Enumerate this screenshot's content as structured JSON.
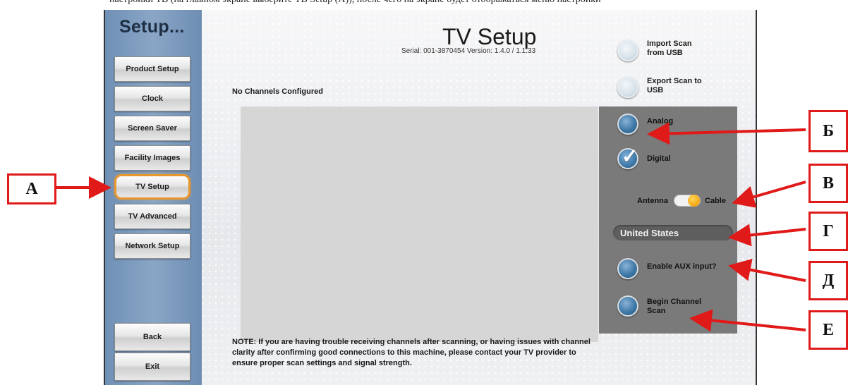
{
  "top_strip_text": "настройки ТВ (на главном экране выберите ТВ Setup (А)), после чего на экране будет отображаться меню настройки",
  "sidebar": {
    "title": "Setup...",
    "items": [
      {
        "label": "Product Setup"
      },
      {
        "label": "Clock"
      },
      {
        "label": "Screen Saver"
      },
      {
        "label": "Facility Images"
      },
      {
        "label": "TV Setup",
        "active": true
      },
      {
        "label": "TV Advanced"
      },
      {
        "label": "Network Setup"
      }
    ],
    "back_label": "Back",
    "exit_label": "Exit"
  },
  "header": {
    "title": "TV Setup",
    "serial": "Serial: 001-3870454   Version: 1.4.0 / 1.1.33"
  },
  "channels_status": "No Channels Configured",
  "options": {
    "import_scan": "Import Scan from USB",
    "export_scan": "Export Scan to USB",
    "analog": "Analog",
    "digital": "Digital",
    "digital_checked": true,
    "antenna": "Antenna",
    "cable": "Cable",
    "source_selected": "Cable",
    "country": "United States",
    "enable_aux": "Enable AUX input?",
    "begin_scan": "Begin Channel Scan"
  },
  "note": "NOTE: If you are having trouble receiving channels after scanning, or having issues with channel clarity after confirming good connections to this machine, please contact your TV provider to ensure proper scan settings and signal strength.",
  "callouts": {
    "a": "А",
    "b": "Б",
    "v": "В",
    "g": "Г",
    "d": "Д",
    "e": "Е"
  },
  "colors": {
    "sidebar": "#7f9cbf",
    "active_outline": "#e8962e",
    "panel": "#7a7a7a",
    "annotation_red": "#e01919",
    "toggle_knob": "#f5a60f"
  }
}
